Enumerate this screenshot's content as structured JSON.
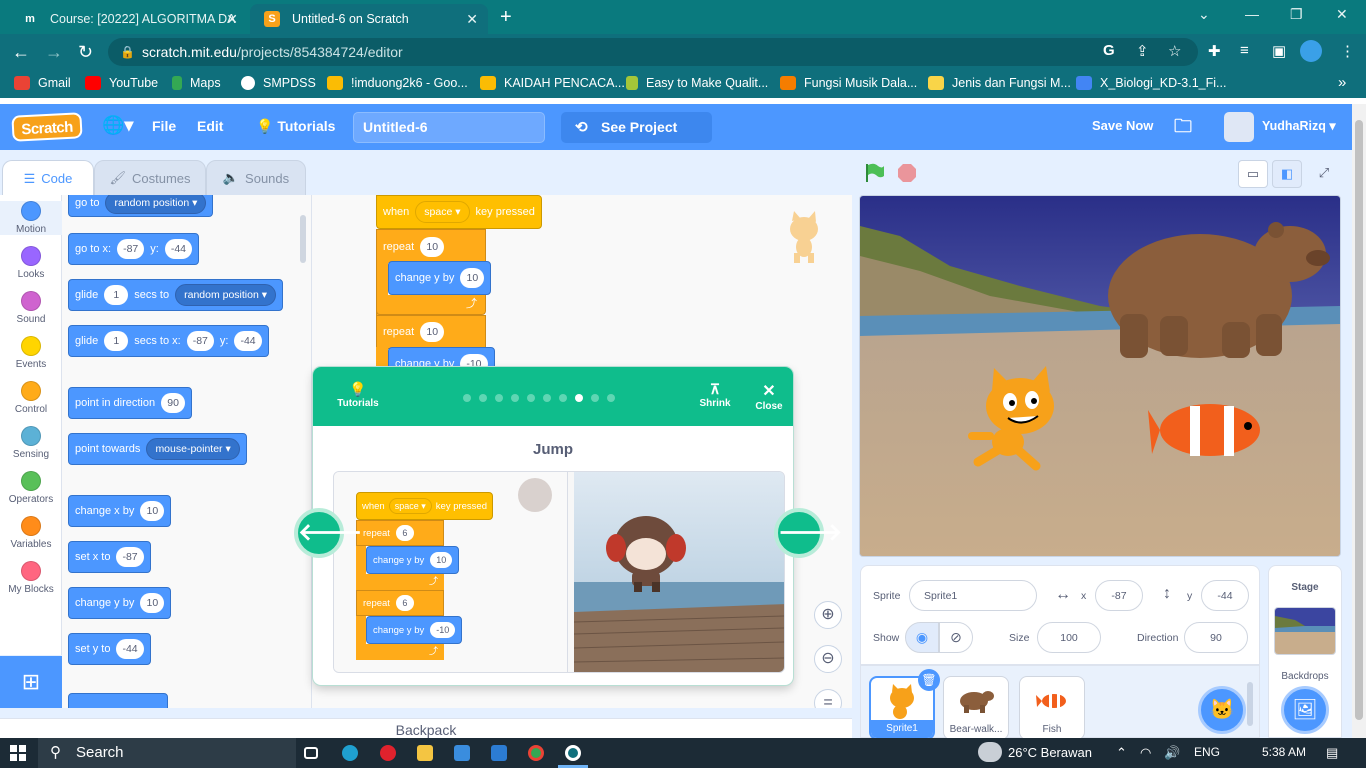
{
  "browser": {
    "tabs": [
      {
        "title": "Course: [20222] ALGORITMA DA",
        "favicon": "m",
        "close": "✕"
      },
      {
        "title": "Untitled-6 on Scratch",
        "favicon": "S",
        "close": "✕"
      }
    ],
    "new_tab": "+",
    "url_host": "scratch.mit.edu",
    "url_path": "/projects/854384724/editor",
    "bookmarks": [
      "Gmail",
      "YouTube",
      "Maps",
      "SMPDSS",
      "!imduong2k6 - Goo...",
      "KAIDAH PENCACA...",
      "Easy to Make Qualit...",
      "Fungsi Musik Dala...",
      "Jenis dan Fungsi M...",
      "X_Biologi_KD-3.1_Fi..."
    ],
    "more_bookmarks": "»"
  },
  "menubar": {
    "logo": "Scratch",
    "file": "File",
    "edit": "Edit",
    "tutorials": "Tutorials",
    "project_title": "Untitled-6",
    "see_project_page": "See Project Page",
    "save_now": "Save Now",
    "username": "YudhaRizq"
  },
  "editor_tabs": {
    "code": "Code",
    "costumes": "Costumes",
    "sounds": "Sounds"
  },
  "categories": [
    {
      "label": "Motion",
      "color": "#4c97ff"
    },
    {
      "label": "Looks",
      "color": "#9966ff"
    },
    {
      "label": "Sound",
      "color": "#cf63cf"
    },
    {
      "label": "Events",
      "color": "#ffd500"
    },
    {
      "label": "Control",
      "color": "#ffab19"
    },
    {
      "label": "Sensing",
      "color": "#5cb1d6"
    },
    {
      "label": "Operators",
      "color": "#59c059"
    },
    {
      "label": "Variables",
      "color": "#ff8c1a"
    },
    {
      "label": "My Blocks",
      "color": "#ff6680"
    }
  ],
  "palette": {
    "goto_label": "go to",
    "goto_target": "random position",
    "gotoxy_label": "go to x:",
    "gotoxy_x": "-87",
    "gotoxy_y_label": "y:",
    "gotoxy_y": "-44",
    "glide_label": "glide",
    "glide_secs": "1",
    "glide_secs_to": "secs to",
    "glide_target": "random position",
    "glidexy_secs": "1",
    "glidexy_secs_to": "secs to x:",
    "glidexy_x": "-87",
    "glidexy_y_label": "y:",
    "glidexy_y": "-44",
    "point_dir_label": "point in direction",
    "point_dir_value": "90",
    "point_towards_label": "point towards",
    "point_towards_target": "mouse-pointer",
    "change_x_label": "change x by",
    "change_x_value": "10",
    "set_x_label": "set x to",
    "set_x_value": "-87",
    "change_y_label": "change y by",
    "change_y_value": "10",
    "set_y_label": "set y to",
    "set_y_value": "-44"
  },
  "script": {
    "when_label": "when",
    "key": "space",
    "key_pressed": "key pressed",
    "repeat_label": "repeat",
    "repeat1": "10",
    "change_y_label": "change y by",
    "change1": "10",
    "repeat2": "10",
    "change2": "-10"
  },
  "tutorial": {
    "tutorials_label": "Tutorials",
    "shrink": "Shrink",
    "close": "Close",
    "title": "Jump",
    "steps_total": 10,
    "step_current": 8,
    "demo": {
      "when_label": "when",
      "key": "space",
      "key_pressed": "key pressed",
      "repeat_label": "repeat",
      "repeat1": "6",
      "change_label": "change y by",
      "change1": "10",
      "repeat2": "6",
      "change2": "-10"
    }
  },
  "backpack": "Backpack",
  "sprite_info": {
    "sprite_label": "Sprite",
    "sprite_name": "Sprite1",
    "x_label": "x",
    "x": "-87",
    "y_label": "y",
    "y": "-44",
    "show_label": "Show",
    "size_label": "Size",
    "size": "100",
    "direction_label": "Direction",
    "direction": "90"
  },
  "sprites": [
    {
      "name": "Sprite1",
      "selected": true
    },
    {
      "name": "Bear-walk...",
      "selected": false
    },
    {
      "name": "Fish",
      "selected": false
    }
  ],
  "stage_panel": {
    "title": "Stage",
    "backdrops": "Backdrops"
  },
  "taskbar": {
    "search": "Search",
    "weather": "26°C  Berawan",
    "lang": "ENG",
    "time": "5:38 AM"
  }
}
